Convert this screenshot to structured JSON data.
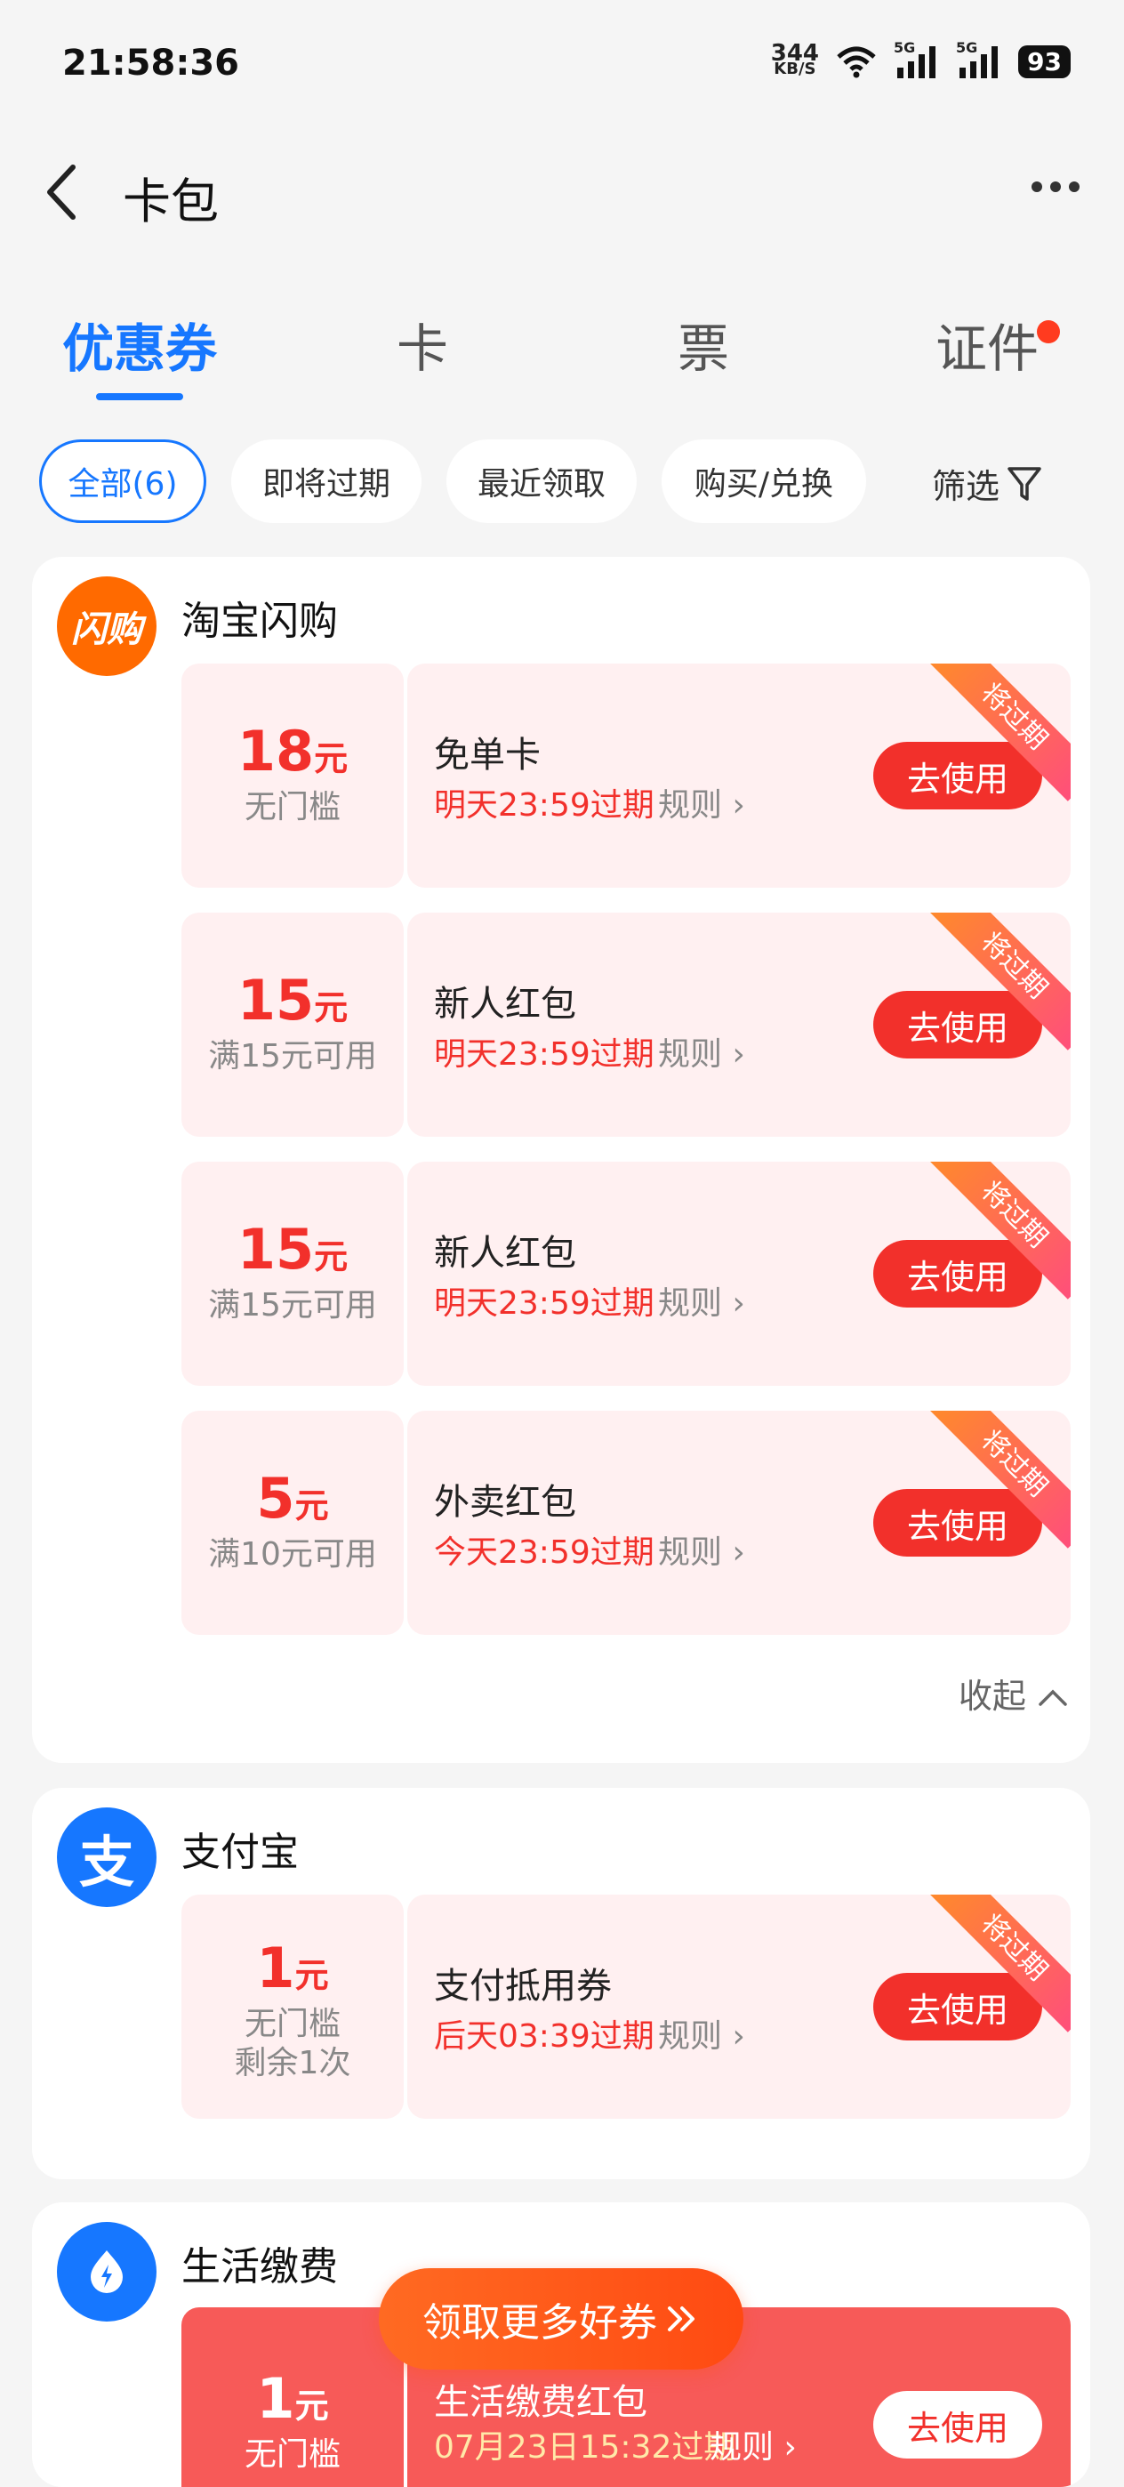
{
  "status_bar": {
    "time": "21:58:36",
    "net_speed": "344",
    "net_unit": "KB/S",
    "net1": "5G",
    "net2": "5G",
    "battery": "93"
  },
  "header": {
    "title": "卡包"
  },
  "tabs": [
    {
      "label": "优惠券"
    },
    {
      "label": "卡"
    },
    {
      "label": "票"
    },
    {
      "label": "证件"
    }
  ],
  "chips": [
    {
      "label": "全部(6)"
    },
    {
      "label": "即将过期"
    },
    {
      "label": "最近领取"
    },
    {
      "label": "购买/兑换"
    }
  ],
  "filter_label": "筛选",
  "groups": [
    {
      "brand": "淘宝闪购",
      "logo_text": "闪购",
      "logo_color": "#ff6a00",
      "coupons": [
        {
          "amount": "18",
          "unit": "元",
          "cond": "无门槛",
          "name": "免单卡",
          "expire": "明天23:59过期",
          "rule": "规则",
          "btn": "去使用",
          "tag": "将过期"
        },
        {
          "amount": "15",
          "unit": "元",
          "cond": "满15元可用",
          "name": "新人红包",
          "expire": "明天23:59过期",
          "rule": "规则",
          "btn": "去使用",
          "tag": "将过期"
        },
        {
          "amount": "15",
          "unit": "元",
          "cond": "满15元可用",
          "name": "新人红包",
          "expire": "明天23:59过期",
          "rule": "规则",
          "btn": "去使用",
          "tag": "将过期"
        },
        {
          "amount": "5",
          "unit": "元",
          "cond": "满10元可用",
          "name": "外卖红包",
          "expire": "今天23:59过期",
          "rule": "规则",
          "btn": "去使用",
          "tag": "将过期"
        }
      ],
      "collapse_label": "收起"
    },
    {
      "brand": "支付宝",
      "logo_text": "支",
      "logo_color": "#1677ff",
      "coupons": [
        {
          "amount": "1",
          "unit": "元",
          "cond": "无门槛",
          "cond2": "剩余1次",
          "name": "支付抵用券",
          "expire": "后天03:39过期",
          "rule": "规则",
          "btn": "去使用",
          "tag": "将过期"
        }
      ]
    },
    {
      "brand": "生活缴费",
      "logo_color": "#1677ff",
      "coupons": [
        {
          "amount": "1",
          "unit": "元",
          "cond": "无门槛",
          "name": "生活缴费红包",
          "expire": "07月23日15:32过期",
          "rule": "规则",
          "btn": "去使用"
        }
      ]
    }
  ],
  "fab_label": "领取更多好券"
}
